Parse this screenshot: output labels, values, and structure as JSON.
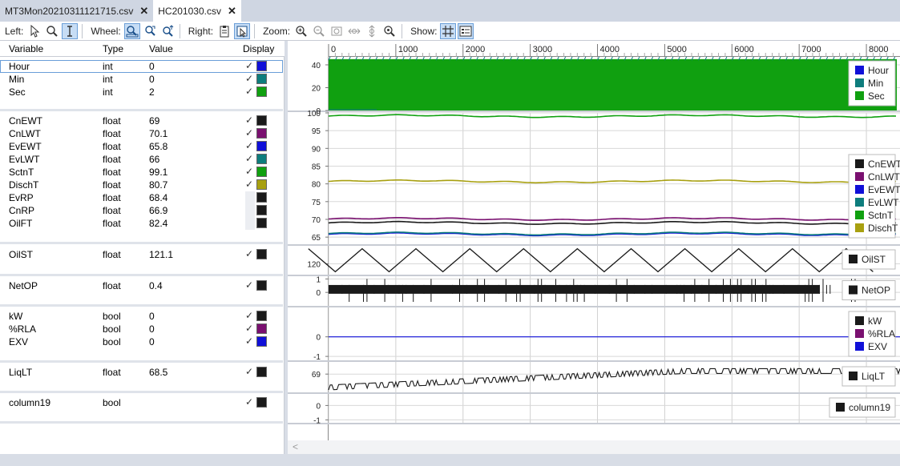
{
  "tabs": [
    {
      "label": "MT3Mon20210311121715.csv",
      "active": false
    },
    {
      "label": "HC201030.csv",
      "active": true
    }
  ],
  "toolbar": {
    "left_label": "Left:",
    "wheel_label": "Wheel:",
    "right_label": "Right:",
    "zoom_label": "Zoom:",
    "show_label": "Show:"
  },
  "table": {
    "headers": {
      "variable": "Variable",
      "type": "Type",
      "value": "Value",
      "display": "Display"
    },
    "groups": [
      {
        "rows": [
          {
            "name": "Hour",
            "type": "int",
            "value": "0",
            "checked": true,
            "color": "#1010d8"
          },
          {
            "name": "Min",
            "type": "int",
            "value": "0",
            "checked": true,
            "color": "#0e7d7d"
          },
          {
            "name": "Sec",
            "type": "int",
            "value": "2",
            "checked": true,
            "color": "#10a010"
          }
        ]
      },
      {
        "rows": [
          {
            "name": "CnEWT",
            "type": "float",
            "value": "69",
            "checked": true,
            "color": "#1a1a1a"
          },
          {
            "name": "CnLWT",
            "type": "float",
            "value": "70.1",
            "checked": true,
            "color": "#7a1070"
          },
          {
            "name": "EvEWT",
            "type": "float",
            "value": "65.8",
            "checked": true,
            "color": "#1010d8"
          },
          {
            "name": "EvLWT",
            "type": "float",
            "value": "66",
            "checked": true,
            "color": "#0e7d7d"
          },
          {
            "name": "SctnT",
            "type": "float",
            "value": "99.1",
            "checked": true,
            "color": "#10a010"
          },
          {
            "name": "DischT",
            "type": "float",
            "value": "80.7",
            "checked": true,
            "color": "#a8a010"
          },
          {
            "name": "EvRP",
            "type": "float",
            "value": "68.4",
            "checked": false,
            "color": "#1a1a1a"
          },
          {
            "name": "CnRP",
            "type": "float",
            "value": "66.9",
            "checked": false,
            "color": "#1a1a1a"
          },
          {
            "name": "OilFT",
            "type": "float",
            "value": "82.4",
            "checked": false,
            "color": "#1a1a1a"
          }
        ]
      },
      {
        "rows": [
          {
            "name": "OilST",
            "type": "float",
            "value": "121.1",
            "checked": true,
            "color": "#1a1a1a"
          }
        ]
      },
      {
        "rows": [
          {
            "name": "NetOP",
            "type": "float",
            "value": "0.4",
            "checked": true,
            "color": "#1a1a1a"
          }
        ]
      },
      {
        "rows": [
          {
            "name": "kW",
            "type": "bool",
            "value": "0",
            "checked": true,
            "color": "#1a1a1a"
          },
          {
            "name": "%RLA",
            "type": "bool",
            "value": "0",
            "checked": true,
            "color": "#7a1070"
          },
          {
            "name": "EXV",
            "type": "bool",
            "value": "0",
            "checked": true,
            "color": "#1010d8"
          }
        ]
      },
      {
        "rows": [
          {
            "name": "LiqLT",
            "type": "float",
            "value": "68.5",
            "checked": true,
            "color": "#1a1a1a"
          }
        ]
      },
      {
        "rows": [
          {
            "name": "column19",
            "type": "bool",
            "value": "",
            "checked": true,
            "color": "#1a1a1a"
          }
        ]
      }
    ]
  },
  "chart_data": {
    "type": "line",
    "x_ticks": [
      "0",
      "1000",
      "2000",
      "3000",
      "4000",
      "5000",
      "6000",
      "7000",
      "8000"
    ],
    "xlim": [
      0,
      8500
    ],
    "grid": true,
    "panels": [
      {
        "y_ticks": [
          "40",
          "20",
          "0"
        ],
        "ylim": [
          0,
          47
        ],
        "series": [
          {
            "name": "Hour",
            "color": "#1010d8"
          },
          {
            "name": "Min",
            "color": "#0e7d7d"
          },
          {
            "name": "Sec",
            "color": "#10a010"
          }
        ]
      },
      {
        "y_ticks": [
          "100",
          "95",
          "90",
          "85",
          "80",
          "75",
          "70",
          "65"
        ],
        "ylim": [
          63,
          100
        ],
        "series": [
          {
            "name": "CnEWT",
            "color": "#1a1a1a",
            "level": 69
          },
          {
            "name": "CnLWT",
            "color": "#7a1070",
            "level": 70.1
          },
          {
            "name": "EvEWT",
            "color": "#1010d8",
            "level": 65.8
          },
          {
            "name": "EvLWT",
            "color": "#0e7d7d",
            "level": 66
          },
          {
            "name": "SctnT",
            "color": "#10a010",
            "level": 99.1
          },
          {
            "name": "DischT",
            "color": "#a8a010",
            "level": 80.7
          }
        ]
      },
      {
        "y_ticks": [
          "120"
        ],
        "ylim": [
          117,
          125
        ],
        "series": [
          {
            "name": "OilST",
            "color": "#1a1a1a"
          }
        ]
      },
      {
        "y_ticks": [
          "1",
          "0"
        ],
        "ylim": [
          -1,
          1.2
        ],
        "series": [
          {
            "name": "NetOP",
            "color": "#1a1a1a"
          }
        ]
      },
      {
        "y_ticks": [
          "0",
          "-1"
        ],
        "ylim": [
          -1.2,
          1.5
        ],
        "series": [
          {
            "name": "kW",
            "color": "#1a1a1a"
          },
          {
            "name": "%RLA",
            "color": "#7a1070"
          },
          {
            "name": "EXV",
            "color": "#1010d8",
            "level": 0
          }
        ]
      },
      {
        "y_ticks": [
          "69"
        ],
        "ylim": [
          67.5,
          70
        ],
        "series": [
          {
            "name": "LiqLT",
            "color": "#1a1a1a"
          }
        ]
      },
      {
        "y_ticks": [
          "0",
          "-1"
        ],
        "ylim": [
          -1.2,
          0.8
        ],
        "series": [
          {
            "name": "column19",
            "color": "#1a1a1a"
          }
        ]
      }
    ]
  }
}
